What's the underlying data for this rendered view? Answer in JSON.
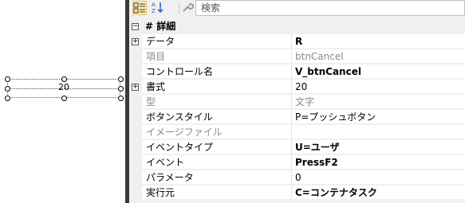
{
  "canvas": {
    "control_value": "20"
  },
  "toolbar": {
    "search_placeholder": "検索"
  },
  "category": {
    "toggle": "−",
    "label": "# 詳細"
  },
  "rows": [
    {
      "name": "データ",
      "value": "R",
      "expand": "+",
      "disabled": false,
      "bold": true
    },
    {
      "name": "項目",
      "value": "btnCancel",
      "expand": "",
      "disabled": true,
      "bold": false
    },
    {
      "name": "コントロール名",
      "value": "V_btnCancel",
      "expand": "",
      "disabled": false,
      "bold": true
    },
    {
      "name": "書式",
      "value": "20",
      "expand": "+",
      "disabled": false,
      "bold": false
    },
    {
      "name": "型",
      "value": "文字",
      "expand": "",
      "disabled": true,
      "bold": false
    },
    {
      "name": "ボタンスタイル",
      "value": "P=プッシュボタン",
      "expand": "",
      "disabled": false,
      "bold": false
    },
    {
      "name": "イメージファイル",
      "value": "",
      "expand": "",
      "disabled": true,
      "bold": false
    },
    {
      "name": "イベントタイプ",
      "value": "U=ユーザ",
      "expand": "",
      "disabled": false,
      "bold": true
    },
    {
      "name": "イベント",
      "value": "PressF2",
      "expand": "",
      "disabled": false,
      "bold": true
    },
    {
      "name": "パラメータ",
      "value": "0",
      "expand": "",
      "disabled": false,
      "bold": false
    },
    {
      "name": "実行元",
      "value": "C=コンテナタスク",
      "expand": "",
      "disabled": false,
      "bold": true
    }
  ]
}
